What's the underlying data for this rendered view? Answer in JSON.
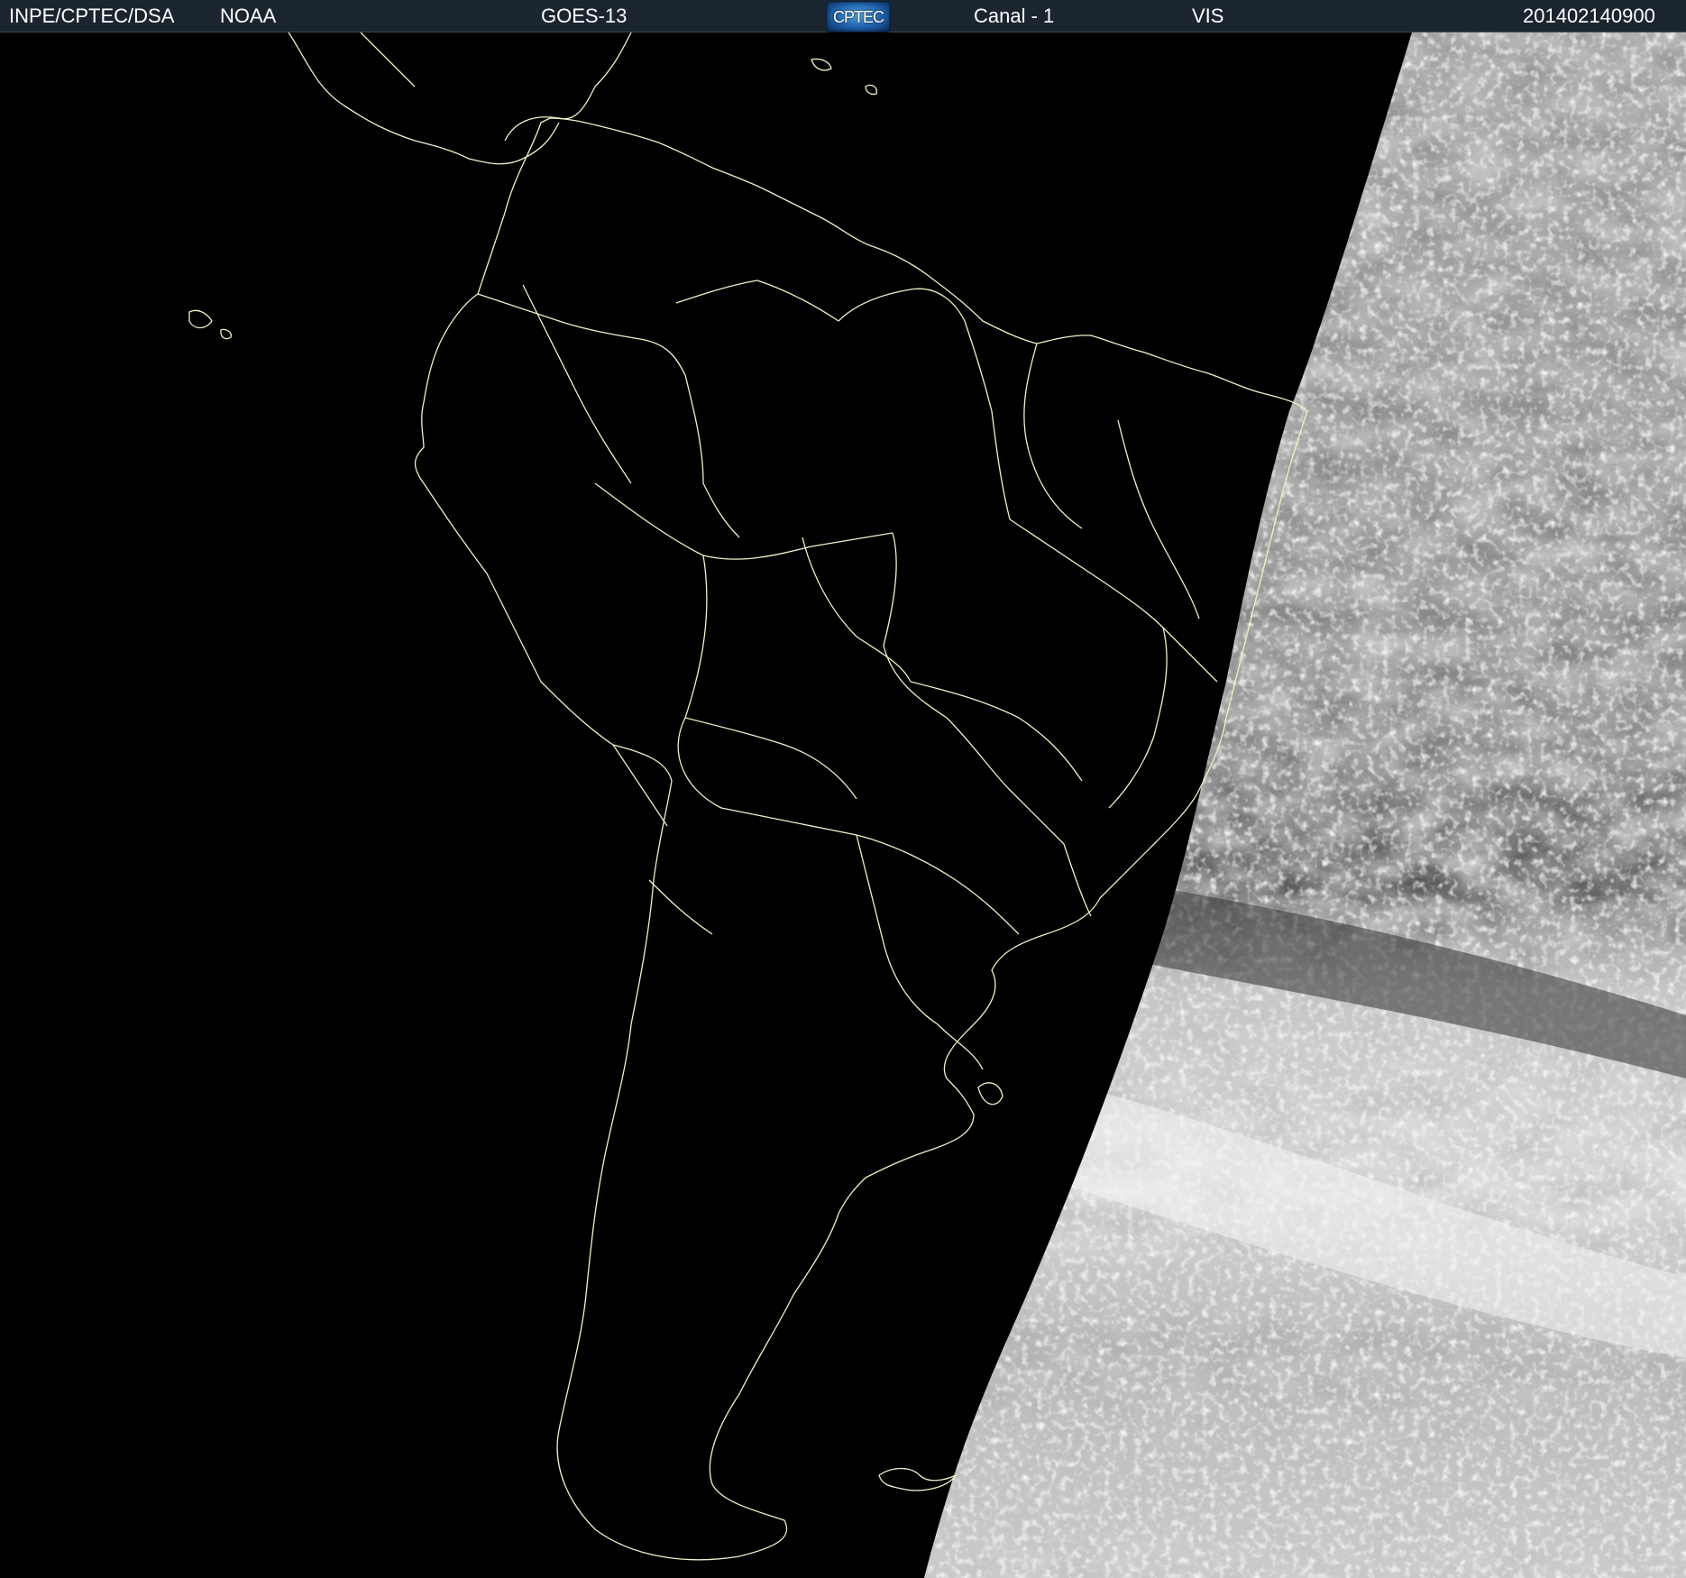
{
  "header": {
    "institution": "INPE/CPTEC/DSA",
    "agency": "NOAA",
    "satellite": "GOES-13",
    "logo_text": "CPTEC",
    "channel": "Canal - 1",
    "band": "VIS",
    "timestamp": "201402140900"
  },
  "colors": {
    "header_bg": "#1a2530",
    "header_text": "#ffffff",
    "night_side": "#000000",
    "boundary_lines": "#f2f0c8",
    "cloud_bright": "#e8e8e8",
    "cloud_gray": "#7a7a7a"
  },
  "map": {
    "region": "South America",
    "projection_view": "satellite imagery, day/night terminator",
    "icons": [
      "cptec-logo"
    ]
  }
}
